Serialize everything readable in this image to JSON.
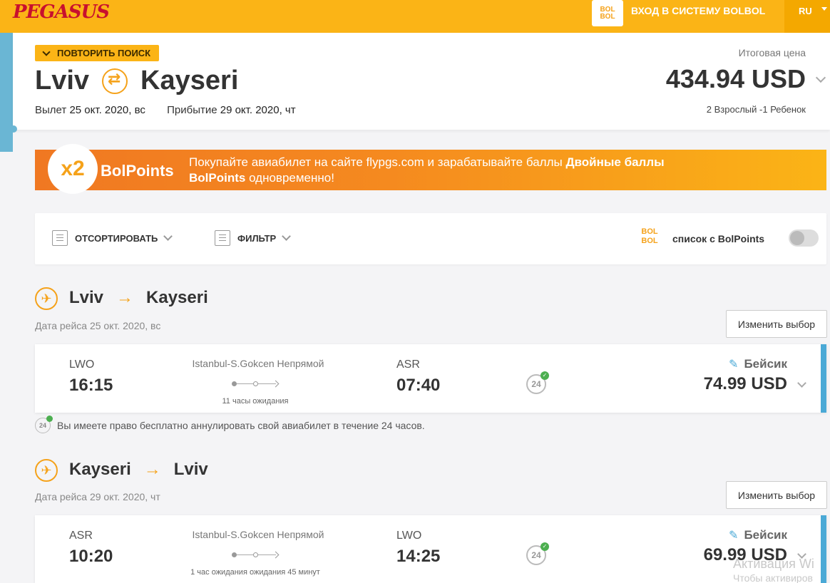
{
  "header": {
    "logo": "PEGASUS",
    "bolbol_top": "BOL",
    "bolbol_bottom": "BOL",
    "login": "ВХОД В СИСТЕМУ BOLBOL",
    "lang": "RU"
  },
  "search": {
    "repeat_label": "ПОВТОРИТЬ ПОИСК",
    "from": "Lviv",
    "to": "Kayseri",
    "depart_label": "Вылет",
    "depart_date": "25 окт. 2020, вс",
    "arrive_label": "Прибытие",
    "arrive_date": "29 окт. 2020, чт",
    "total_label": "Итоговая цена",
    "total_price": "434.94 USD",
    "passengers": "2 Взрослый -1 Ребенок"
  },
  "banner": {
    "badge": "x2",
    "title": "BolPoints",
    "text_pre": "Покупайте авиабилет на сайте flypgs.com и зарабатывайте баллы ",
    "text_bold": "Двойные баллы BolPoints",
    "text_post": " одновременно!"
  },
  "filters": {
    "sort_label": "ОТСОРТИРОВАТЬ",
    "filter_label": "ФИЛЬТР",
    "bp_logo_top": "BOL",
    "bp_logo_bottom": "BOL",
    "bp_list_label": "список с BolPoints"
  },
  "outbound": {
    "from": "Lviv",
    "to": "Kayseri",
    "date": "Дата рейса 25 окт. 2020, вс",
    "change_label": "Изменить выбор",
    "dep_code": "LWO",
    "dep_time": "16:15",
    "via": "Istanbul-S.Gokcen Непрямой",
    "wait": "11 часы ожидания",
    "arr_code": "ASR",
    "arr_time": "07:40",
    "h24": "24",
    "fare": "Бейсик",
    "price": "74.99 USD"
  },
  "cancel_note": {
    "h24": "24",
    "text": "Вы имеете право бесплатно аннулировать свой авиабилет в течение 24 часов."
  },
  "inbound": {
    "from": "Kayseri",
    "to": "Lviv",
    "date": "Дата рейса 29 окт. 2020, чт",
    "change_label": "Изменить выбор",
    "dep_code": "ASR",
    "dep_time": "10:20",
    "via": "Istanbul-S.Gokcen Непрямой",
    "wait": "1 час ожидания ожидания 45 минут",
    "arr_code": "LWO",
    "arr_time": "14:25",
    "h24": "24",
    "fare": "Бейсик",
    "price": "69.99 USD"
  },
  "watermark": {
    "line1": "Активация Wi",
    "line2": "Чтобы активиров"
  }
}
